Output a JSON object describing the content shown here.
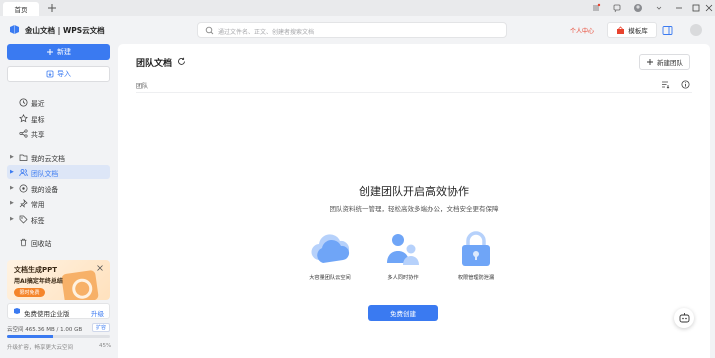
{
  "tabs": {
    "home_label": "首页"
  },
  "header": {
    "brand": "金山文档 | WPS云文档",
    "search_placeholder": "通过文件名、正文、创建者搜索文档",
    "personal_center": "个人中心",
    "template_label": "模板库"
  },
  "sidebar": {
    "new_label": "新建",
    "import_label": "导入",
    "items": [
      {
        "label": "最近",
        "icon": "clock-icon"
      },
      {
        "label": "星标",
        "icon": "star-icon"
      },
      {
        "label": "共享",
        "icon": "share-icon"
      },
      {
        "label": "我的云文档",
        "icon": "folder-icon"
      },
      {
        "label": "团队文档",
        "icon": "team-icon",
        "active": true
      },
      {
        "label": "我的设备",
        "icon": "device-icon"
      },
      {
        "label": "常用",
        "icon": "pin-icon"
      },
      {
        "label": "标签",
        "icon": "tag-icon"
      },
      {
        "label": "回收站",
        "icon": "trash-icon"
      }
    ],
    "promo": {
      "title": "文档生成PPT",
      "subtitle": "用AI搞定年终总结",
      "cta": "限时免费"
    },
    "enterprise": {
      "label": "免费使用企业版",
      "upgrade": "升级"
    },
    "storage": {
      "text": "云空间 465.36 MB / 1.00 GB",
      "expand": "扩容",
      "hint": "升级扩容，畅享更大云空间",
      "percent_label": "45%",
      "fraction": 0.45
    }
  },
  "main": {
    "title": "团队文档",
    "new_team_label": "新建团队",
    "column_team": "团队",
    "empty_title": "创建团队开启高效协作",
    "empty_subtitle": "团队资料统一管理，轻松高效多端办公，文档安全更有保障",
    "features": [
      {
        "label": "大容量团队云空间",
        "icon": "cloud-icon"
      },
      {
        "label": "多人同时协作",
        "icon": "people-icon"
      },
      {
        "label": "权限管理防泄漏",
        "icon": "lock-icon"
      }
    ],
    "create_label": "免费创建"
  },
  "colors": {
    "accent": "#3a7af1",
    "active_bg": "#dde6f7",
    "personal": "#e8432e",
    "promo_cta": "#f5852a"
  }
}
